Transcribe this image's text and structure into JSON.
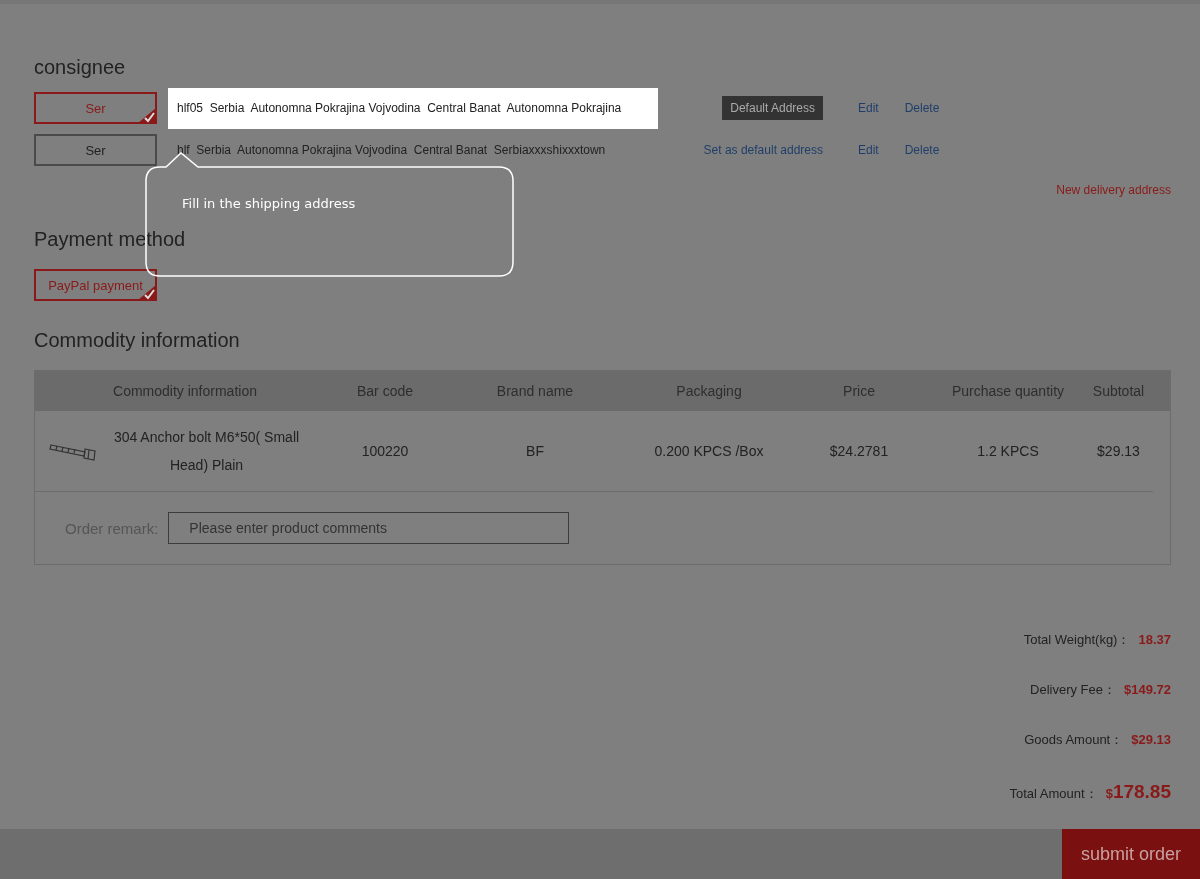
{
  "consignee": {
    "title": "consignee",
    "addresses": [
      {
        "name": "Ser",
        "selected": true,
        "highlighted": true,
        "text": "hlf05  Serbia  Autonomna Pokrajina Vojvodina  Central Banat  Autonomna Pokrajina",
        "kind": "default",
        "action": "Default Address",
        "edit": "Edit",
        "delete": "Delete"
      },
      {
        "name": "Ser",
        "selected": false,
        "highlighted": false,
        "text": "hlf  Serbia  Autonomna Pokrajina Vojvodina  Central Banat  Serbiaxxxshixxxtown",
        "kind": "link",
        "action": "Set as default address",
        "edit": "Edit",
        "delete": "Delete"
      }
    ],
    "new_address": "New delivery address"
  },
  "tooltip": {
    "text": "Fill in the shipping address"
  },
  "payment": {
    "title": "Payment method",
    "options": [
      {
        "label": "PayPal payment",
        "selected": true
      }
    ]
  },
  "commodity": {
    "title": "Commodity information",
    "table": {
      "columns": [
        "Commodity information",
        "Bar code",
        "Brand name",
        "Packaging",
        "Price",
        "Purchase quantity",
        "Subtotal"
      ],
      "rows": [
        {
          "name": "304 Anchor bolt M6*50( Small Head) Plain",
          "bar_code": "100220",
          "brand": "BF",
          "packaging": "0.200 KPCS /Box",
          "price": "$24.2781",
          "quantity": "1.2 KPCS",
          "subtotal": "$29.13"
        }
      ]
    },
    "remark": {
      "label": "Order remark:",
      "placeholder": "Please enter product comments"
    }
  },
  "totals": [
    {
      "label": "Total Weight(kg)：",
      "value": "18.37",
      "kind": "normal"
    },
    {
      "label": "Delivery Fee：",
      "value": "$149.72",
      "kind": "normal"
    },
    {
      "label": "Goods Amount：",
      "value": "$29.13",
      "kind": "normal"
    },
    {
      "label": "Total Amount：",
      "currency": "$",
      "value": "178.85",
      "kind": "grand"
    }
  ],
  "submit": "submit order"
}
